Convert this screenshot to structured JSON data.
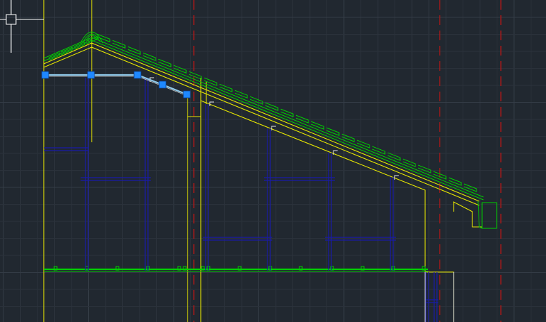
{
  "app": {
    "view": "model-space",
    "background": "#212830"
  },
  "colors": {
    "grid_minor": "#2b323b",
    "grid_major": "#343c46",
    "yellow": "#e6e600",
    "green": "#00d000",
    "blue": "#1a1aa8",
    "red": "#b01818",
    "white": "#e8e8e8",
    "cyan": "#8fc8e8",
    "grip": "#1e88ff",
    "crosshair": "#ffffff"
  },
  "drawing": {
    "object": "roof section with gable ridge, rafters, battens, posts and gutter",
    "selected_polyline_grips": 5,
    "selection_state": "selected"
  },
  "cursor": {
    "type": "crosshair",
    "pickbox": true
  },
  "icons": {
    "crosshair": "crosshair-cursor-icon",
    "grip": "grip-square-icon",
    "snap": "snap-marker-icon"
  }
}
